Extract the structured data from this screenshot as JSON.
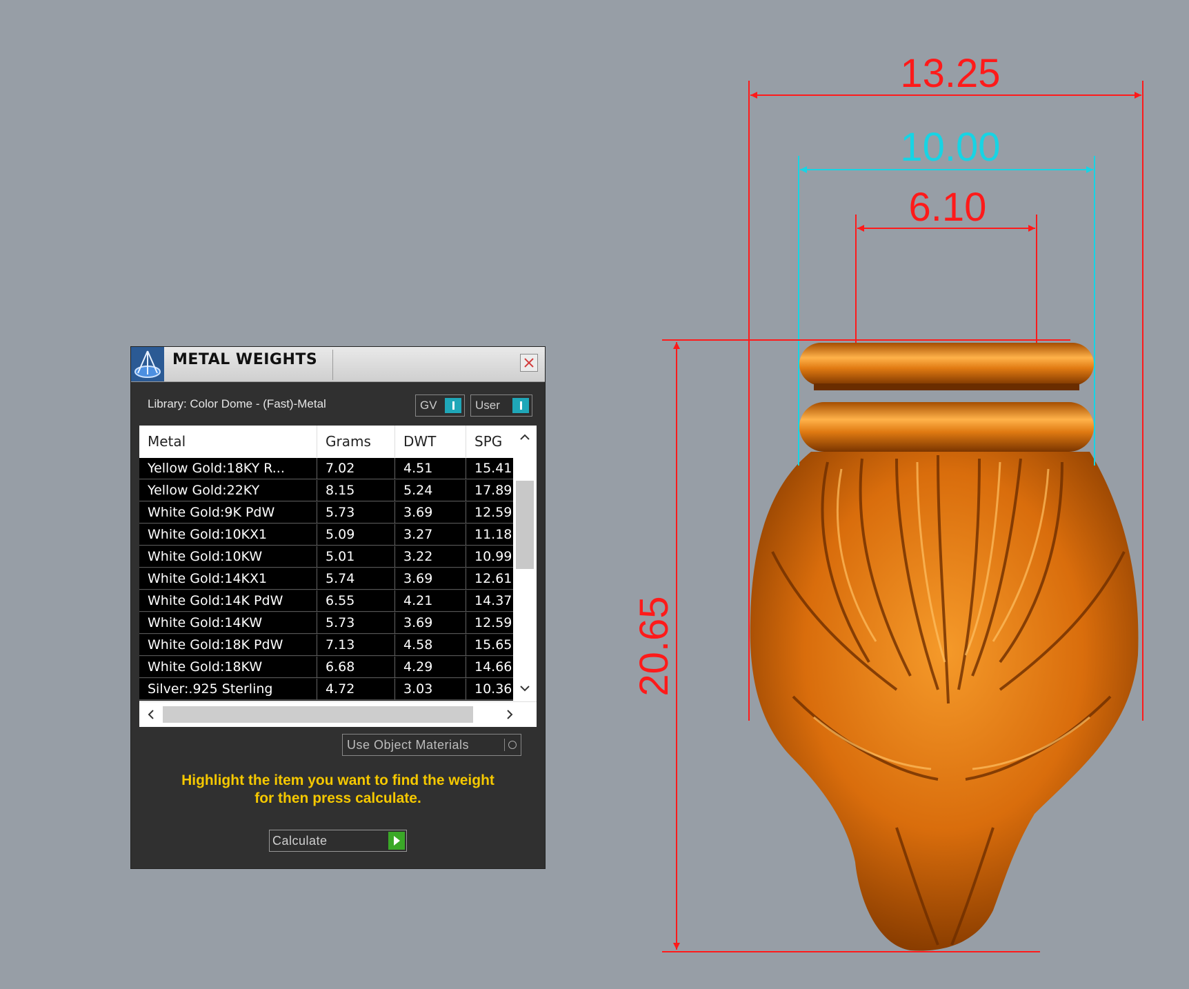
{
  "dimensions": {
    "overall_width": "13.25",
    "inner_width": "10.00",
    "top_width": "6.10",
    "height": "20.65"
  },
  "colors": {
    "dimension_red": "#ff1a1a",
    "dimension_cyan": "#17d4e4",
    "metal_orange": "#e67a12",
    "hint_yellow": "#f5c800",
    "calc_green": "#3aa827"
  },
  "panel": {
    "title": "METAL WEIGHTS",
    "library": "Library: Color Dome - (Fast)-Metal",
    "toggles": {
      "gv": "GV",
      "user": "User"
    },
    "columns": [
      "Metal",
      "Grams",
      "DWT",
      "SPG"
    ],
    "rows": [
      [
        "Yellow Gold:18KY R...",
        "7.02",
        "4.51",
        "15.41"
      ],
      [
        "Yellow Gold:22KY",
        "8.15",
        "5.24",
        "17.89"
      ],
      [
        "White Gold:9K PdW",
        "5.73",
        "3.69",
        "12.59"
      ],
      [
        "White Gold:10KX1",
        "5.09",
        "3.27",
        "11.18"
      ],
      [
        "White Gold:10KW",
        "5.01",
        "3.22",
        "10.99"
      ],
      [
        "White Gold:14KX1",
        "5.74",
        "3.69",
        "12.61"
      ],
      [
        "White Gold:14K PdW",
        "6.55",
        "4.21",
        "14.37"
      ],
      [
        "White Gold:14KW",
        "5.73",
        "3.69",
        "12.59"
      ],
      [
        "White Gold:18K PdW",
        "7.13",
        "4.58",
        "15.65"
      ],
      [
        "White Gold:18KW",
        "6.68",
        "4.29",
        "14.66"
      ],
      [
        "Silver:.925 Sterling",
        "4.72",
        "3.03",
        "10.36"
      ]
    ],
    "use_object_materials": "Use Object Materials",
    "hint_line1": "Highlight the item you want to find the weight",
    "hint_line2": "for then press calculate.",
    "calculate": "Calculate"
  }
}
